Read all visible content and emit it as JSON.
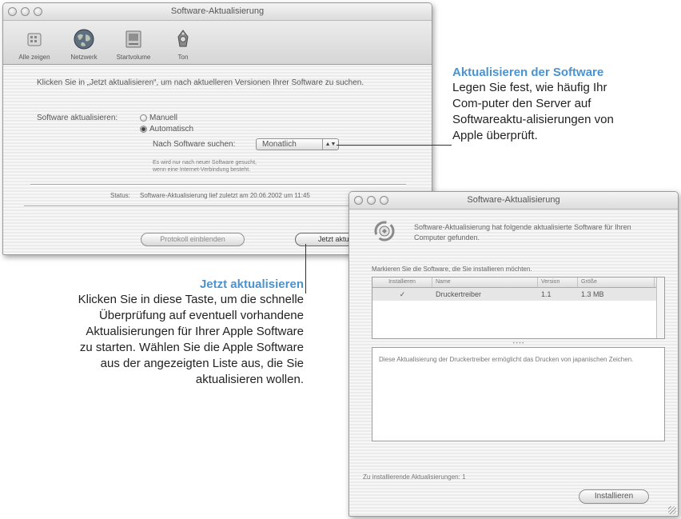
{
  "window1": {
    "title": "Software-Aktualisierung",
    "toolbar": [
      {
        "label": "Alle zeigen",
        "icon": "show-all-icon"
      },
      {
        "label": "Netzwerk",
        "icon": "network-globe-icon"
      },
      {
        "label": "Startvolume",
        "icon": "startup-disk-icon"
      },
      {
        "label": "Ton",
        "icon": "speaker-icon"
      }
    ],
    "description": "Klicken Sie in „Jetzt aktualisieren“, um nach aktuelleren Versionen Ihrer Software zu suchen.",
    "update_label": "Software aktualisieren:",
    "radio_manual": "Manuell",
    "radio_automatic": "Automatisch",
    "search_label": "Nach Software suchen:",
    "interval_selected": "Monatlich",
    "note_line1": "Es wird nur nach neuer Software gesucht,",
    "note_line2": "wenn eine Internet-Verbindung besteht.",
    "status_label": "Status:",
    "status_text": "Software-Aktualisierung lief zuletzt am 20.06.2002 um 11:45",
    "btn_installed": "Protokoll einblenden",
    "btn_update_now": "Jetzt aktualisieren"
  },
  "callout_top": {
    "heading": "Aktualisieren der Software",
    "line1": "Legen Sie fest, wie häufig Ihr",
    "line2": "Com-puter den Server auf",
    "line3": "Softwareaktu-alisierungen von",
    "line4": "Apple überprüft."
  },
  "callout_bottom": {
    "heading": "Jetzt aktualisieren",
    "line1": "Klicken Sie in diese Taste, um die schnelle",
    "line2": "Überprüfung auf eventuell vorhandene",
    "line3": "Aktualisierungen für Ihrer Apple Software",
    "line4": "zu starten. Wählen Sie die Apple Software",
    "line5": "aus der angezeigten Liste aus, die Sie",
    "line6": "aktualisieren wollen."
  },
  "window2": {
    "title": "Software-Aktualisierung",
    "message": "Software-Aktualisierung hat folgende aktualisierte Software für Ihren Computer gefunden.",
    "mark_text": "Markieren Sie die Software, die Sie installieren möchten.",
    "columns": [
      "Installieren",
      "Name",
      "Version",
      "Größe"
    ],
    "rows": [
      {
        "install": "✓",
        "name": "Druckertreiber",
        "version": "1.1",
        "size": "1.3 MB"
      }
    ],
    "detail": "Diese Aktualisierung der Druckertreiber ermöglicht das Drucken von japanischen Zeichen.",
    "count_text": "Zu installierende Aktualisierungen: 1",
    "install_button": "Installieren"
  }
}
